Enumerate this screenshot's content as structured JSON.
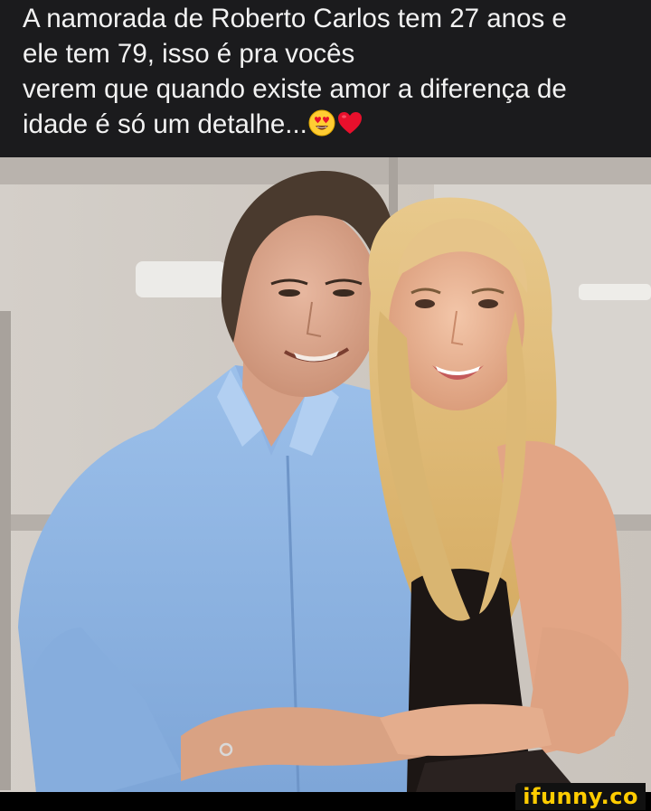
{
  "caption": {
    "line1": "A namorada de Roberto Carlos tem 27 anos e",
    "line2": "ele tem 79, isso é pra vocês",
    "line3": "verem que quando existe amor a diferença de",
    "line4": "idade é só um detalhe...",
    "emojis": [
      "heart-eyes-emoji",
      "red-heart-emoji"
    ]
  },
  "photo": {
    "subject": "photo-couple"
  },
  "watermark": {
    "text": "ifunny.co"
  },
  "colors": {
    "background": "#1b1b1d",
    "caption_text": "#f2f2f2",
    "watermark": "#ffcc00"
  }
}
